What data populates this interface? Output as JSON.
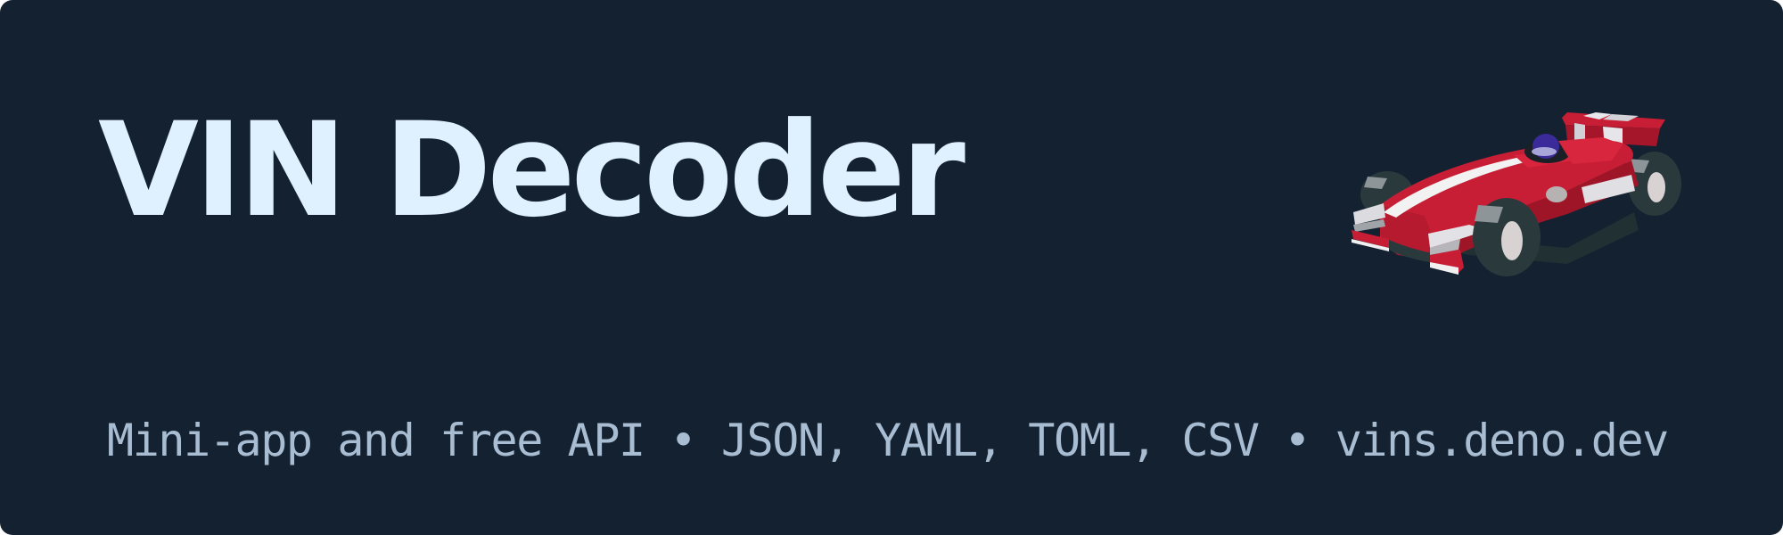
{
  "banner": {
    "title": "VIN Decoder",
    "subtitle": "Mini-app and free API • JSON, YAML, TOML, CSV • vins.deno.dev",
    "illustration_icon": "race-car-icon"
  },
  "colors": {
    "background": "#132131",
    "title": "#dff0fe",
    "subtitle": "#a9bdd2",
    "car_body": "#c81e35"
  }
}
